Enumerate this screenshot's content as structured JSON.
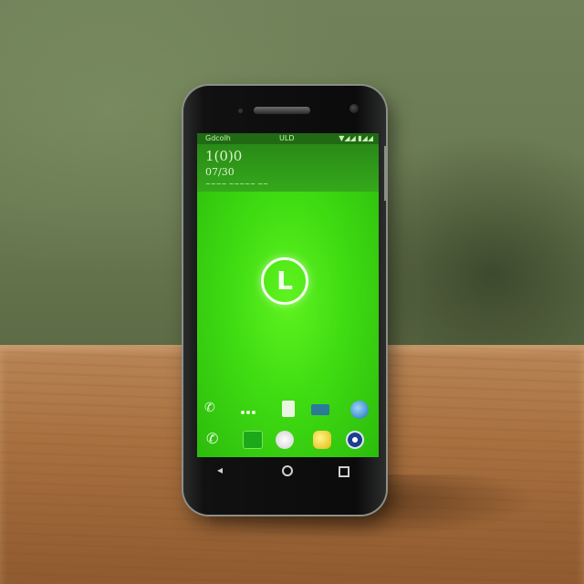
{
  "scene": {
    "wall_color": "#6f7f55",
    "table_color": "#a8703f"
  },
  "phone": {
    "status_bar": {
      "carrier": "Gdcolh",
      "center": "ULD",
      "right": "▼◢◢ ▮◢◢"
    },
    "lockscreen": {
      "time": "1(0)0",
      "date": "07/30",
      "subtitle": "~~~~ ~~~~~ ~~"
    },
    "center_logo": {
      "letter": "L",
      "color": "#f4ffef",
      "icon": "circle-logo-icon"
    },
    "screen_color": "#3fdc12",
    "app_row_icons": [
      "phone-icon",
      "dots-icon",
      "sim-icon",
      "message-icon",
      "globe-icon"
    ],
    "dock_icons": [
      "dialer-icon",
      "app-square-icon",
      "app-grid-icon",
      "yellow-app-icon",
      "camera-icon"
    ],
    "nav_icons": [
      "back-icon",
      "home-icon",
      "recents-icon"
    ]
  }
}
